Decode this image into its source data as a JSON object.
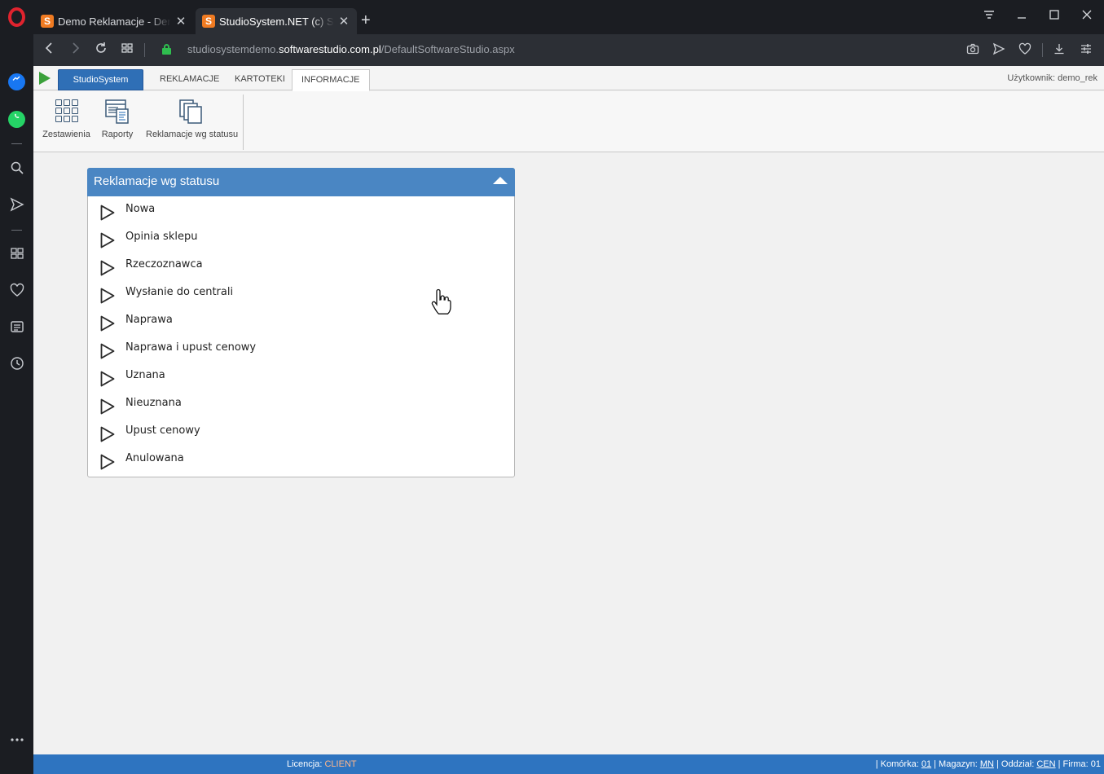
{
  "browser": {
    "tabs": [
      {
        "title": "Demo Reklamacje - Demo Reklamacje",
        "favicon": "S"
      },
      {
        "title": "StudioSystem.NET (c) SoftwareStudio",
        "favicon": "S"
      }
    ],
    "new_tab": "+",
    "url_prefix": "studiosystemdemo.",
    "url_host": "softwarestudio.com.pl",
    "url_path": "/DefaultSoftwareStudio.aspx"
  },
  "app": {
    "app_button": "StudioSystem",
    "tabs": [
      "REKLAMACJE",
      "KARTOTEKI",
      "INFORMACJE"
    ],
    "active_tab": "INFORMACJE",
    "user_label": "Użytkownik: demo_rek",
    "ribbon_buttons": [
      {
        "label": "Zestawienia",
        "icon": "grid-icon"
      },
      {
        "label": "Raporty",
        "icon": "report-icon"
      },
      {
        "label": "Reklamacje wg statusu",
        "icon": "documents-icon"
      }
    ]
  },
  "panel": {
    "title": "Reklamacje wg statusu",
    "items": [
      "Nowa",
      "Opinia sklepu",
      "Rzeczoznawca",
      "Wysłanie do centrali",
      "Naprawa",
      "Naprawa i upust cenowy",
      "Uznana",
      "Nieuznana",
      "Upust cenowy",
      "Anulowana"
    ]
  },
  "statusbar": {
    "license_label": "Licencja:",
    "license_value": "CLIENT",
    "komorka_label": "| Komórka:",
    "komorka_value": "01",
    "magazyn_label": "| Magazyn:",
    "magazyn_value": "MN",
    "oddzial_label": "| Oddział:",
    "oddzial_value": "CEN",
    "firma": "| Firma: 01"
  },
  "colors": {
    "accent": "#2e74c0",
    "panel_header": "#4a86c3",
    "license_value": "#ffb68a"
  }
}
